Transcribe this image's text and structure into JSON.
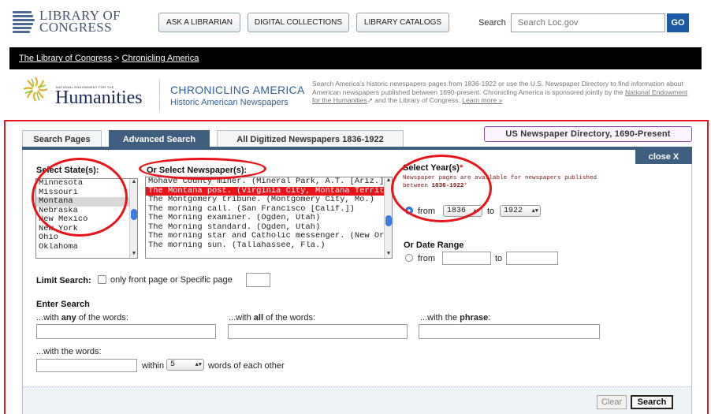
{
  "header": {
    "logo_line1": "LIBRARY OF",
    "logo_line2": "CONGRESS",
    "buttons": [
      "ASK A LIBRARIAN",
      "DIGITAL COLLECTIONS",
      "LIBRARY CATALOGS"
    ],
    "search_label": "Search",
    "search_placeholder": "Search Loc.gov",
    "go_label": "GO"
  },
  "breadcrumb": {
    "home": "The Library of Congress",
    "sep": " > ",
    "current": "Chronicling America"
  },
  "masthead": {
    "neh_small": "NATIONAL ENDOWMENT FOR THE",
    "neh_big": "Humanities",
    "title": "CHRONICLING AMERICA",
    "subtitle": "Historic American Newspapers",
    "desc_part1": "Search America's historic newspapers pages from 1836-1922 or use the U.S. Newspaper Directory to find information about American newspapers published between 1690-present. Chronicling America is sponsored jointly by the ",
    "desc_link": "National Endowment for the Humanities",
    "desc_part2": " and the Library of Congress. ",
    "learn_more": "Learn more »"
  },
  "tabs": {
    "search_pages": "Search Pages",
    "advanced": "Advanced Search",
    "all_digitized": "All Digitized Newspapers 1836-1922",
    "directory": "US Newspaper Directory, 1690-Present",
    "close": "close X"
  },
  "states": {
    "label": "Select State(s):",
    "options": [
      "Minnesota",
      "Missouri",
      "Montana",
      "Nebraska",
      "New Mexico",
      "New York",
      "Ohio",
      "Oklahoma"
    ],
    "selected": "Montana"
  },
  "newspapers": {
    "label": "Or Select Newspaper(s):",
    "options": [
      "Mohave County miner. (Mineral Park, A.T. [Ariz.])",
      "The Montana post. (Virginia City, Montana Territory [i.e. Mo",
      "The Montgomery tribune. (Montgomery City, Mo.)",
      "The morning call. (San Francisco [Calif.])",
      "The Morning examiner. (Ogden, Utah)",
      "The Morning standard. (Ogden, Utah)",
      "The morning star and Catholic messenger. (New Orleans [L",
      "The morning sun. (Tallahassee, Fla.)"
    ],
    "selected": "The Montana post. (Virginia City, Montana Territory [i.e. Mo"
  },
  "years": {
    "label": "Select Year(s)",
    "asterisk": "*",
    "note1": "Newspaper pages are available for newspapers published",
    "note2_pre": "between ",
    "note2_range": "1836-1922",
    "from_label": "from",
    "to_label": "to",
    "from_year": "1836",
    "to_year": "1922",
    "date_range_label": "Or Date Range",
    "dr_from": "from",
    "dr_to": "to"
  },
  "limit": {
    "label": "Limit Search:",
    "text": "only front page or Specific page"
  },
  "enter_search": {
    "heading": "Enter Search",
    "any_pre": "...with ",
    "any_bold": "any",
    "any_post": " of the words:",
    "all_pre": "...with ",
    "all_bold": "all",
    "all_post": " of the words:",
    "phrase_pre": "...with the ",
    "phrase_bold": "phrase",
    "phrase_post": ":",
    "words_label": "...with the words:",
    "within": "within",
    "proximity": "5",
    "words_of_each": "words of each other"
  },
  "actions": {
    "clear": "Clear",
    "search": "Search"
  },
  "colors": {
    "annotation_red": "#e8141a",
    "tab_active": "#3e5f7f",
    "selected_option": "#e8141a"
  }
}
